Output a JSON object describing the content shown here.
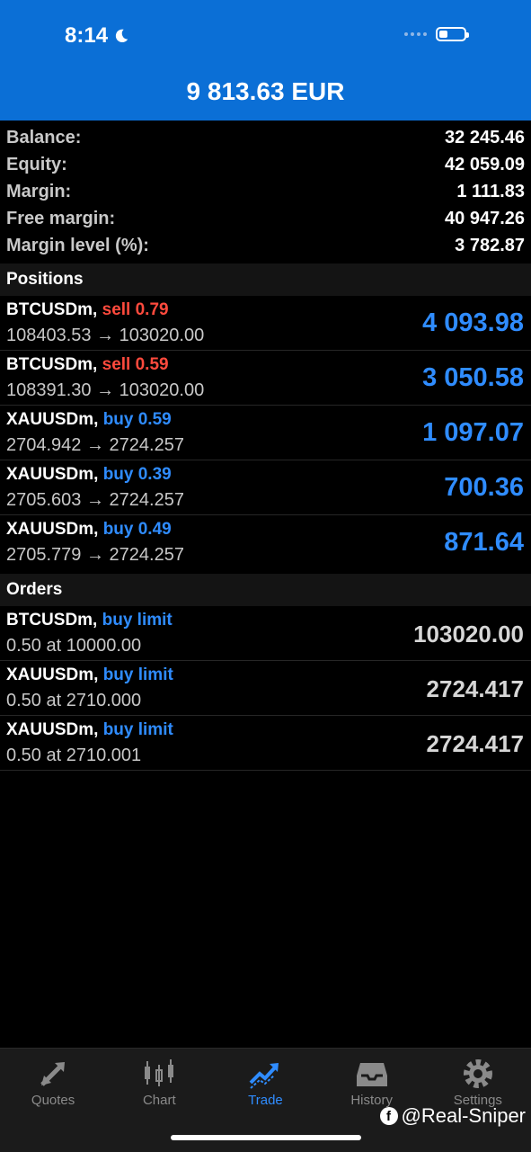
{
  "status_bar": {
    "time": "8:14"
  },
  "header": {
    "title": "9 813.63 EUR"
  },
  "summary": [
    {
      "label": "Balance:",
      "value": "32 245.46"
    },
    {
      "label": "Equity:",
      "value": "42 059.09"
    },
    {
      "label": "Margin:",
      "value": "1 111.83"
    },
    {
      "label": "Free margin:",
      "value": "40 947.26"
    },
    {
      "label": "Margin level (%):",
      "value": "3 782.87"
    }
  ],
  "sections": {
    "positions": "Positions",
    "orders": "Orders"
  },
  "positions": [
    {
      "symbol": "BTCUSDm,",
      "action": "sell 0.79",
      "prices": "108403.53 → 103020.00",
      "profit": "4 093.98"
    },
    {
      "symbol": "BTCUSDm,",
      "action": "sell 0.59",
      "prices": "108391.30 → 103020.00",
      "profit": "3 050.58"
    },
    {
      "symbol": "XAUUSDm,",
      "action": "buy 0.59",
      "prices": "2704.942 → 2724.257",
      "profit": "1 097.07"
    },
    {
      "symbol": "XAUUSDm,",
      "action": "buy 0.39",
      "prices": "2705.603 → 2724.257",
      "profit": "700.36"
    },
    {
      "symbol": "XAUUSDm,",
      "action": "buy 0.49",
      "prices": "2705.779 → 2724.257",
      "profit": "871.64"
    }
  ],
  "orders": [
    {
      "symbol": "BTCUSDm,",
      "action": "buy limit",
      "details": "0.50 at 10000.00",
      "price": "103020.00"
    },
    {
      "symbol": "XAUUSDm,",
      "action": "buy limit",
      "details": "0.50 at 2710.000",
      "price": "2724.417"
    },
    {
      "symbol": "XAUUSDm,",
      "action": "buy limit",
      "details": "0.50 at 2710.001",
      "price": "2724.417"
    }
  ],
  "tabs": [
    {
      "label": "Quotes",
      "icon": "quotes-arrows-icon"
    },
    {
      "label": "Chart",
      "icon": "candlestick-chart-icon"
    },
    {
      "label": "Trade",
      "icon": "trade-trend-icon",
      "active": true
    },
    {
      "label": "History",
      "icon": "inbox-history-icon"
    },
    {
      "label": "Settings",
      "icon": "gear-icon"
    }
  ],
  "watermark": "@Real-Sniper",
  "colors": {
    "header_bg": "#0b6fd6",
    "sell": "#ff4a3d",
    "buy": "#2f8cff"
  }
}
